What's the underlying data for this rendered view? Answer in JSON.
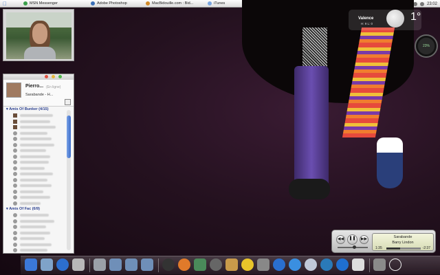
{
  "taskbar": {
    "items": [
      {
        "label": "MSN Messenger",
        "icon": "msn-icon",
        "color": "#3aa04a"
      },
      {
        "label": "Adobe Photoshop",
        "icon": "photoshop-icon",
        "color": "#3a6fb8"
      },
      {
        "label": "MacBidouille.com : Bid...",
        "icon": "browser-icon",
        "color": "#d08a2a"
      },
      {
        "label": "iTunes",
        "icon": "itunes-icon",
        "color": "#7aa6e0"
      }
    ],
    "clock": "23:02"
  },
  "msn": {
    "username": "Pierro...",
    "status": "(En ligne)",
    "now_playing": "Sarabande - H...",
    "groups": [
      {
        "name": "Amis Of Bunker (4/15)",
        "count": 16
      },
      {
        "name": "Amis Of Fac (6/9)",
        "count": 7
      }
    ]
  },
  "weather": {
    "city": "Valence",
    "high_low": "H: 9 L: 0",
    "temperature": "1°"
  },
  "system_gauge": {
    "value": "23%",
    "fraction": 0.23
  },
  "itunes": {
    "song": "Sarabande",
    "artist": "Barry Lindon",
    "elapsed": "1:35",
    "remaining": "-2:37",
    "progress": 0.4
  },
  "dock": {
    "items": [
      "finder-icon",
      "display-icon",
      "globe-icon",
      "system-icon",
      "drive-icon",
      "folder-icon",
      "folder-icon",
      "folder-icon",
      "dashboard-icon",
      "firefox-icon",
      "feather-icon",
      "dvd-icon",
      "image-icon",
      "radiation-icon",
      "app-icon",
      "ie-icon",
      "messages-icon",
      "itunes-icon",
      "camino-icon",
      "quicktime-icon",
      "ipod-icon",
      "trash-icon",
      "plus-icon"
    ]
  }
}
